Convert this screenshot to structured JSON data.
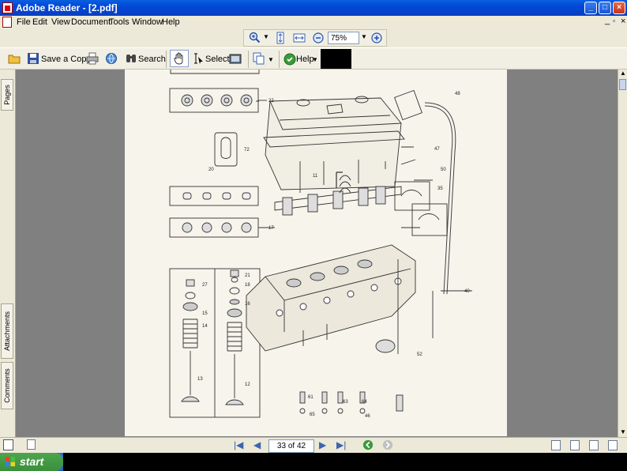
{
  "window": {
    "title": "Adobe Reader - [2.pdf]"
  },
  "menu": [
    "File",
    "Edit",
    "View",
    "Document",
    "Tools",
    "Window",
    "Help"
  ],
  "zoom_toolbar": {
    "zoom_value": "75%"
  },
  "toolbar": {
    "save_copy_label": "Save a Copy",
    "search_label": "Search",
    "select_label": "Select",
    "help_label": "Help"
  },
  "nav_tabs": {
    "pages": "Pages",
    "attachments": "Attachments",
    "comments": "Comments"
  },
  "status": {
    "page_indicator": "33 of 42"
  },
  "taskbar": {
    "start_label": "start"
  },
  "diagram_labels": [
    "22",
    "72",
    "20",
    "17",
    "21",
    "18",
    "16",
    "27",
    "15",
    "14",
    "13",
    "12",
    "47",
    "50",
    "35",
    "48",
    "11",
    "61",
    "52",
    "63",
    "64",
    "65",
    "46",
    "40"
  ]
}
